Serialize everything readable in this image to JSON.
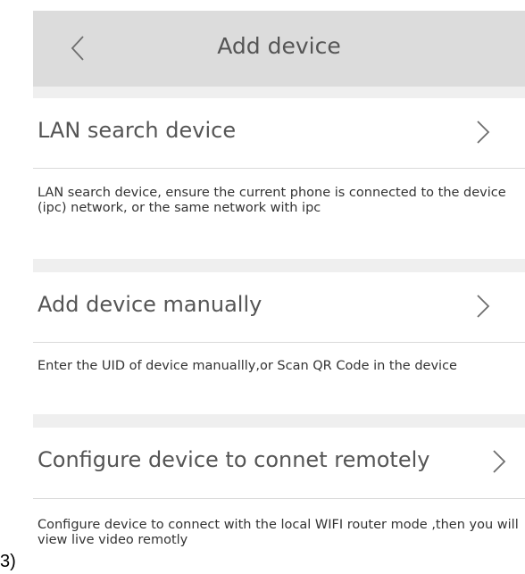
{
  "marker_label": "3)",
  "header": {
    "title": "Add device",
    "back_icon": "chevron-left-icon"
  },
  "options": [
    {
      "label": "LAN search device",
      "icon": "chevron-right-icon",
      "description": "LAN search device, ensure the current phone is connected to the device (ipc) network, or the same network with ipc"
    },
    {
      "label": "Add device manually",
      "icon": "chevron-right-icon",
      "description": "Enter the UID of device manuallly,or Scan QR Code in the device"
    },
    {
      "label": "Configure device to connet remotely",
      "icon": "chevron-right-icon",
      "description": "Configure device to connect with the local WIFI router mode ,then you will view live video remotly"
    }
  ]
}
